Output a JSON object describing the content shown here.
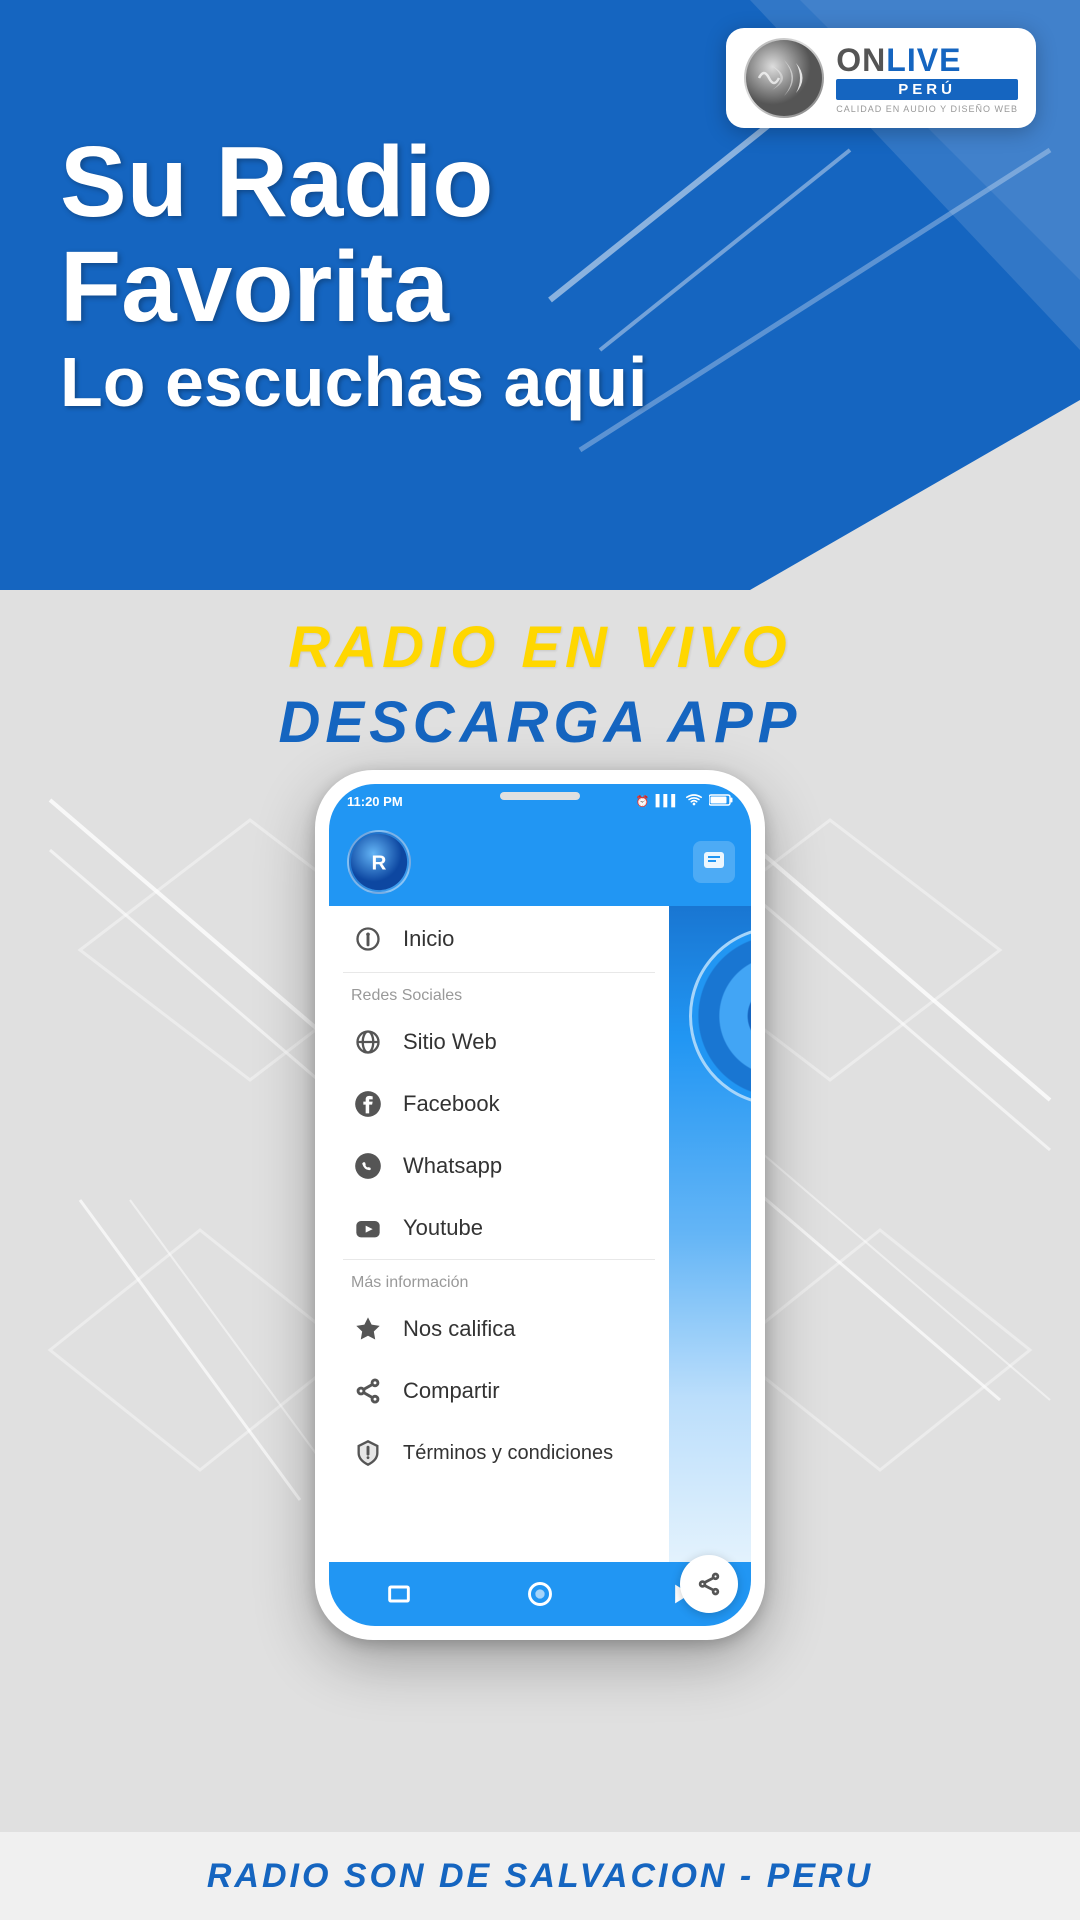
{
  "logo": {
    "on_text": "ON",
    "live_text": "LIVE",
    "peru_text": "PERÚ",
    "tagline": "CALIDAD EN AUDIO Y DISEÑO WEB"
  },
  "header": {
    "headline_line1": "Su Radio",
    "headline_line2": "Favorita",
    "subheadline": "Lo escuchas aqui"
  },
  "promo": {
    "radio_en_vivo": "RADIO  EN  VIVO",
    "descarga_app": "DESCARGA  APP"
  },
  "phone": {
    "status_time": "11:20 PM",
    "status_alarm": "⏰",
    "status_signal": "▌▌▌",
    "status_wifi": "WiFi",
    "status_battery": "🔋"
  },
  "menu": {
    "inicio_label": "Inicio",
    "redes_sociales_header": "Redes Sociales",
    "sitio_web_label": "Sitio Web",
    "facebook_label": "Facebook",
    "whatsapp_label": "Whatsapp",
    "youtube_label": "Youtube",
    "mas_info_header": "Más información",
    "nos_califica_label": "Nos califica",
    "compartir_label": "Compartir",
    "terminos_label": "Términos y condiciones"
  },
  "footer": {
    "text": "RADIO SON DE SALVACION -  PERU"
  }
}
